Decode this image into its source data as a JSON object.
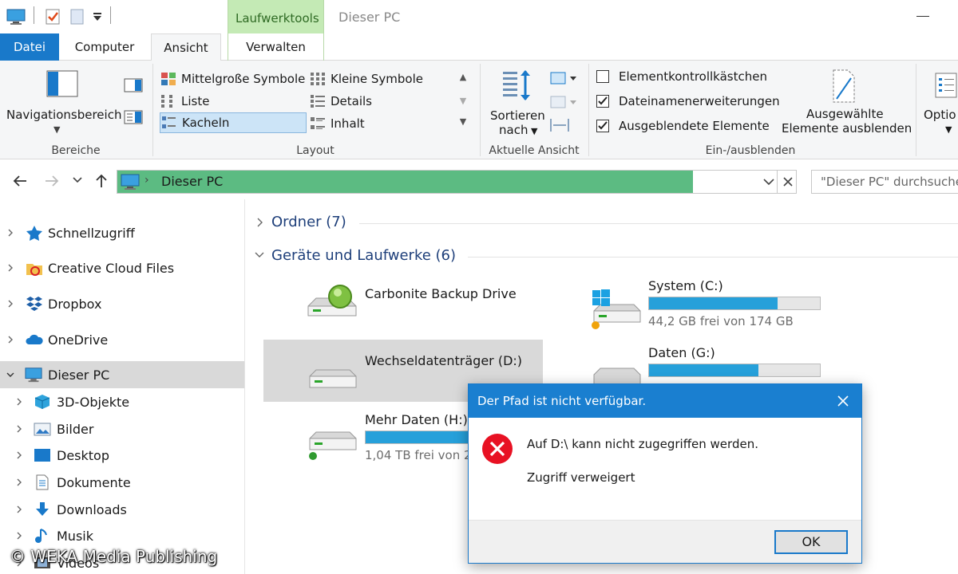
{
  "window": {
    "title": "Dieser PC",
    "context_tab_group": "Laufwerktools"
  },
  "ribbon_tabs": [
    "Datei",
    "Computer",
    "Ansicht",
    "Verwalten"
  ],
  "ribbon": {
    "panes": {
      "label": "Navigationsbereich",
      "group": "Bereiche"
    },
    "layout": {
      "group": "Layout",
      "items": [
        "Mittelgroße Symbole",
        "Kleine Symbole",
        "Liste",
        "Details",
        "Kacheln",
        "Inhalt"
      ],
      "selected": "Kacheln"
    },
    "current_view": {
      "sort_label_1": "Sortieren",
      "sort_label_2": "nach",
      "group": "Aktuelle Ansicht"
    },
    "show_hide": {
      "group": "Ein-/ausblenden",
      "checkboxes": [
        {
          "label": "Elementkontrollkästchen",
          "checked": false
        },
        {
          "label": "Dateinamenerweiterungen",
          "checked": true
        },
        {
          "label": "Ausgeblendete Elemente",
          "checked": true
        }
      ],
      "hide_selected_1": "Ausgewählte",
      "hide_selected_2": "Elemente ausblenden"
    },
    "options": "Optio"
  },
  "address": {
    "path": "Dieser PC",
    "search_placeholder": "\"Dieser PC\" durchsuche"
  },
  "nav_pane": [
    {
      "label": "Schnellzugriff",
      "icon": "star-icon"
    },
    {
      "label": "Creative Cloud Files",
      "icon": "creative-cloud-icon"
    },
    {
      "label": "Dropbox",
      "icon": "dropbox-icon"
    },
    {
      "label": "OneDrive",
      "icon": "onedrive-icon"
    },
    {
      "label": "Dieser PC",
      "icon": "computer-icon",
      "selected": true
    },
    {
      "label": "3D-Objekte",
      "icon": "cube-icon"
    },
    {
      "label": "Bilder",
      "icon": "pictures-icon"
    },
    {
      "label": "Desktop",
      "icon": "desktop-icon"
    },
    {
      "label": "Dokumente",
      "icon": "documents-icon"
    },
    {
      "label": "Downloads",
      "icon": "downloads-icon"
    },
    {
      "label": "Musik",
      "icon": "music-icon"
    },
    {
      "label": "Videos",
      "icon": "videos-icon"
    }
  ],
  "sections": {
    "folders": "Ordner (7)",
    "drives": "Geräte und Laufwerke (6)"
  },
  "drives": {
    "carbonite": {
      "name": "Carbonite Backup Drive"
    },
    "system": {
      "name": "System (C:)",
      "free": "44,2 GB frei von 174 GB",
      "used_fraction": 0.75
    },
    "removable": {
      "name": "Wechseldatenträger (D:)"
    },
    "data": {
      "name": "Daten (G:)",
      "used_fraction": 0.64
    },
    "more": {
      "name": "Mehr Daten (H:)",
      "free": "1,04 TB frei von 2,"
    }
  },
  "dialog": {
    "title": "Der Pfad ist nicht verfügbar.",
    "message": "Auf D:\\ kann nicht zugegriffen werden.",
    "detail": "Zugriff verweigert",
    "ok": "OK"
  },
  "watermark": "© WEKA Media Publishing",
  "colors": {
    "accent": "#1979ca",
    "context_tab": "#c4eab5",
    "address_progress": "#5cbb82",
    "drive_bar": "#26a0da",
    "error": "#e81123"
  }
}
